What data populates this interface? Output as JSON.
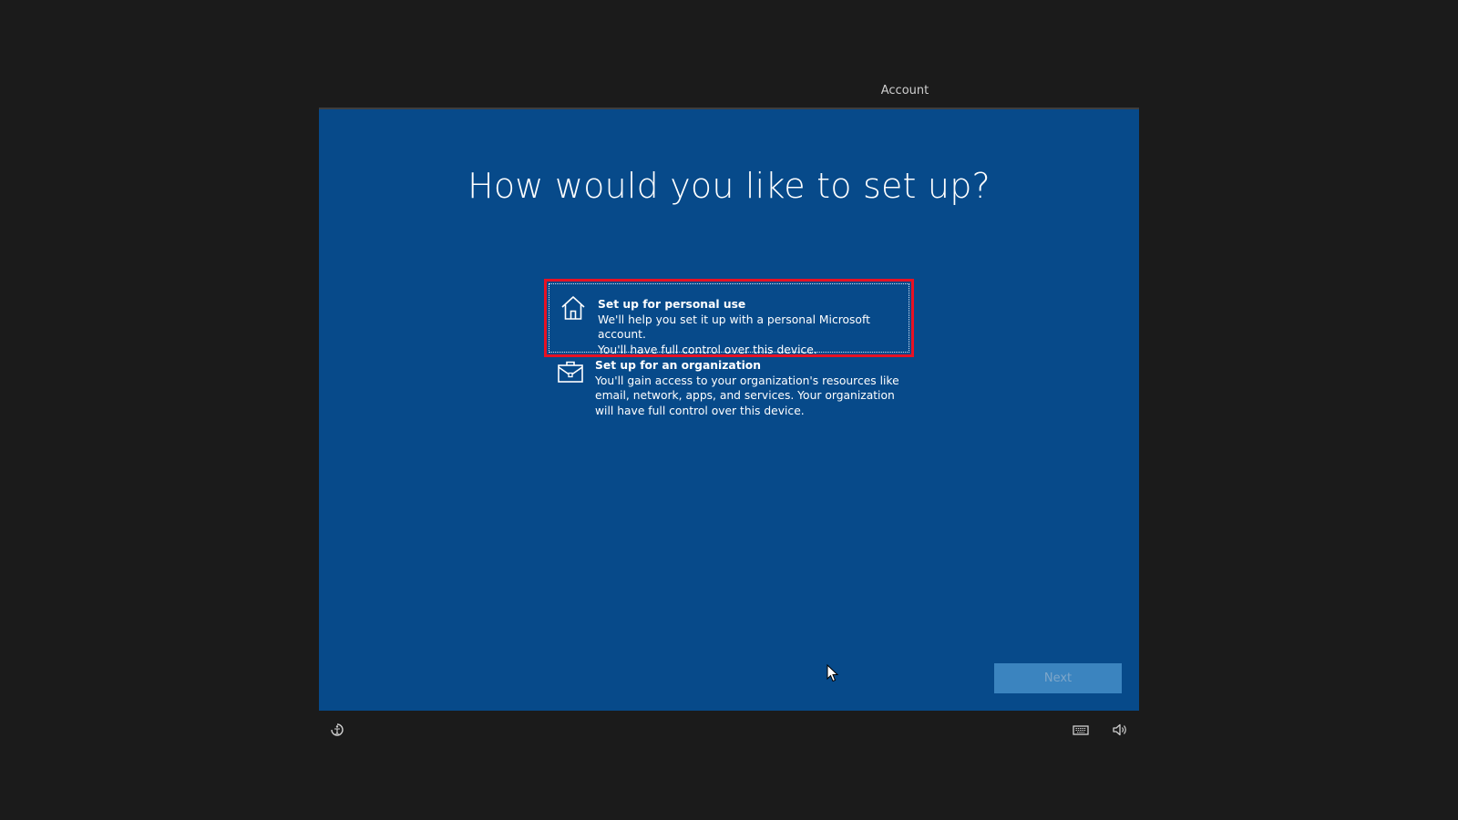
{
  "step": {
    "label": "Account"
  },
  "main": {
    "heading": "How would you like to set up?",
    "options": [
      {
        "title": "Set up for personal use",
        "description_line1": "We'll help you set it up with a personal Microsoft account.",
        "description_line2": "You'll have full control over this device.",
        "icon": "home-icon",
        "selected": true
      },
      {
        "title": "Set up for an organization",
        "description": "You'll gain access to your organization's resources like email, network, apps, and services. Your organization will have full control over this device.",
        "icon": "briefcase-icon",
        "selected": false
      }
    ],
    "next_label": "Next"
  },
  "bottom_bar": {
    "icons": [
      "ease-of-access-icon",
      "keyboard-icon",
      "volume-icon"
    ]
  },
  "colors": {
    "background": "#1b1b1b",
    "panel": "#074a8a",
    "selection_border": "#e81123",
    "next_button": "#3b84bf"
  }
}
